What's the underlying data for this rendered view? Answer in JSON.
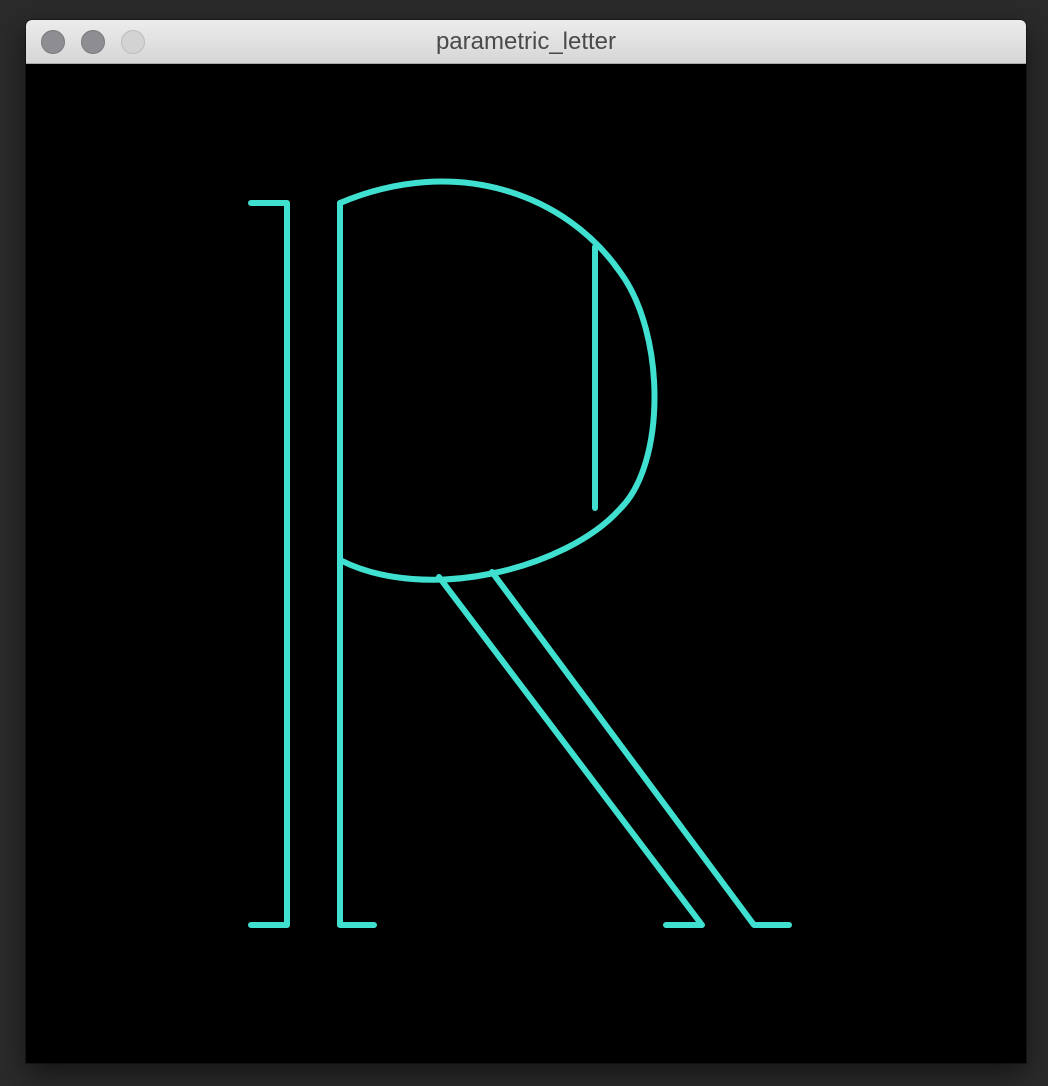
{
  "window": {
    "title": "parametric_letter"
  },
  "titlebar": {
    "buttons": [
      {
        "name": "close-button",
        "color": "#8e8e92"
      },
      {
        "name": "minimize-button",
        "color": "#8e8e92"
      },
      {
        "name": "zoom-button",
        "color": "#d3d3d3"
      }
    ]
  },
  "canvas": {
    "background": "#000000",
    "stroke_color": "#40e0d0",
    "glyph": "letter-R-outline"
  }
}
